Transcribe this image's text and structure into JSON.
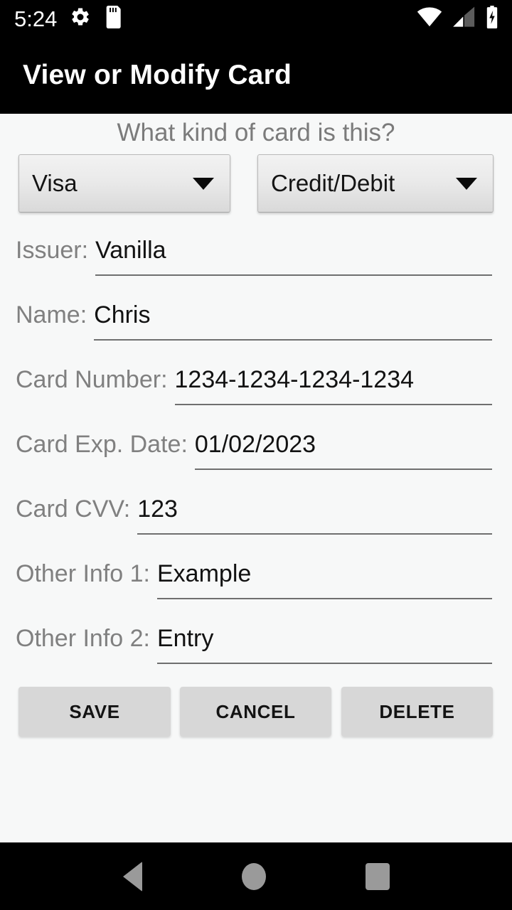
{
  "status_bar": {
    "time": "5:24",
    "icons": [
      "gear-icon",
      "sd-card-icon",
      "wifi-icon",
      "cellular-signal-icon",
      "battery-charging-icon"
    ]
  },
  "app_bar": {
    "title": "View or Modify Card"
  },
  "form": {
    "question": "What kind of card is this?",
    "spinners": [
      {
        "name": "card-brand",
        "value": "Visa"
      },
      {
        "name": "card-type",
        "value": "Credit/Debit"
      }
    ],
    "fields": [
      {
        "label": "Issuer:",
        "value": "Vanilla"
      },
      {
        "label": "Name:",
        "value": "Chris"
      },
      {
        "label": "Card Number:",
        "value": "1234-1234-1234-1234"
      },
      {
        "label": "Card Exp. Date:",
        "value": "01/02/2023"
      },
      {
        "label": "Card CVV:",
        "value": "123"
      },
      {
        "label": "Other Info 1:",
        "value": "Example"
      },
      {
        "label": "Other Info 2:",
        "value": "Entry"
      }
    ],
    "buttons": [
      {
        "name": "save",
        "label": "SAVE"
      },
      {
        "name": "cancel",
        "label": "CANCEL"
      },
      {
        "name": "delete",
        "label": "DELETE"
      }
    ]
  },
  "nav_bar": {
    "items": [
      "back-icon",
      "home-icon",
      "recents-icon"
    ]
  },
  "colors": {
    "app_bar_background": "#000000",
    "page_background": "#f7f8f8",
    "label_text": "#808080",
    "value_text": "#121212",
    "button_background": "#d7d7d7",
    "nav_icon": "#9a9a9a"
  }
}
